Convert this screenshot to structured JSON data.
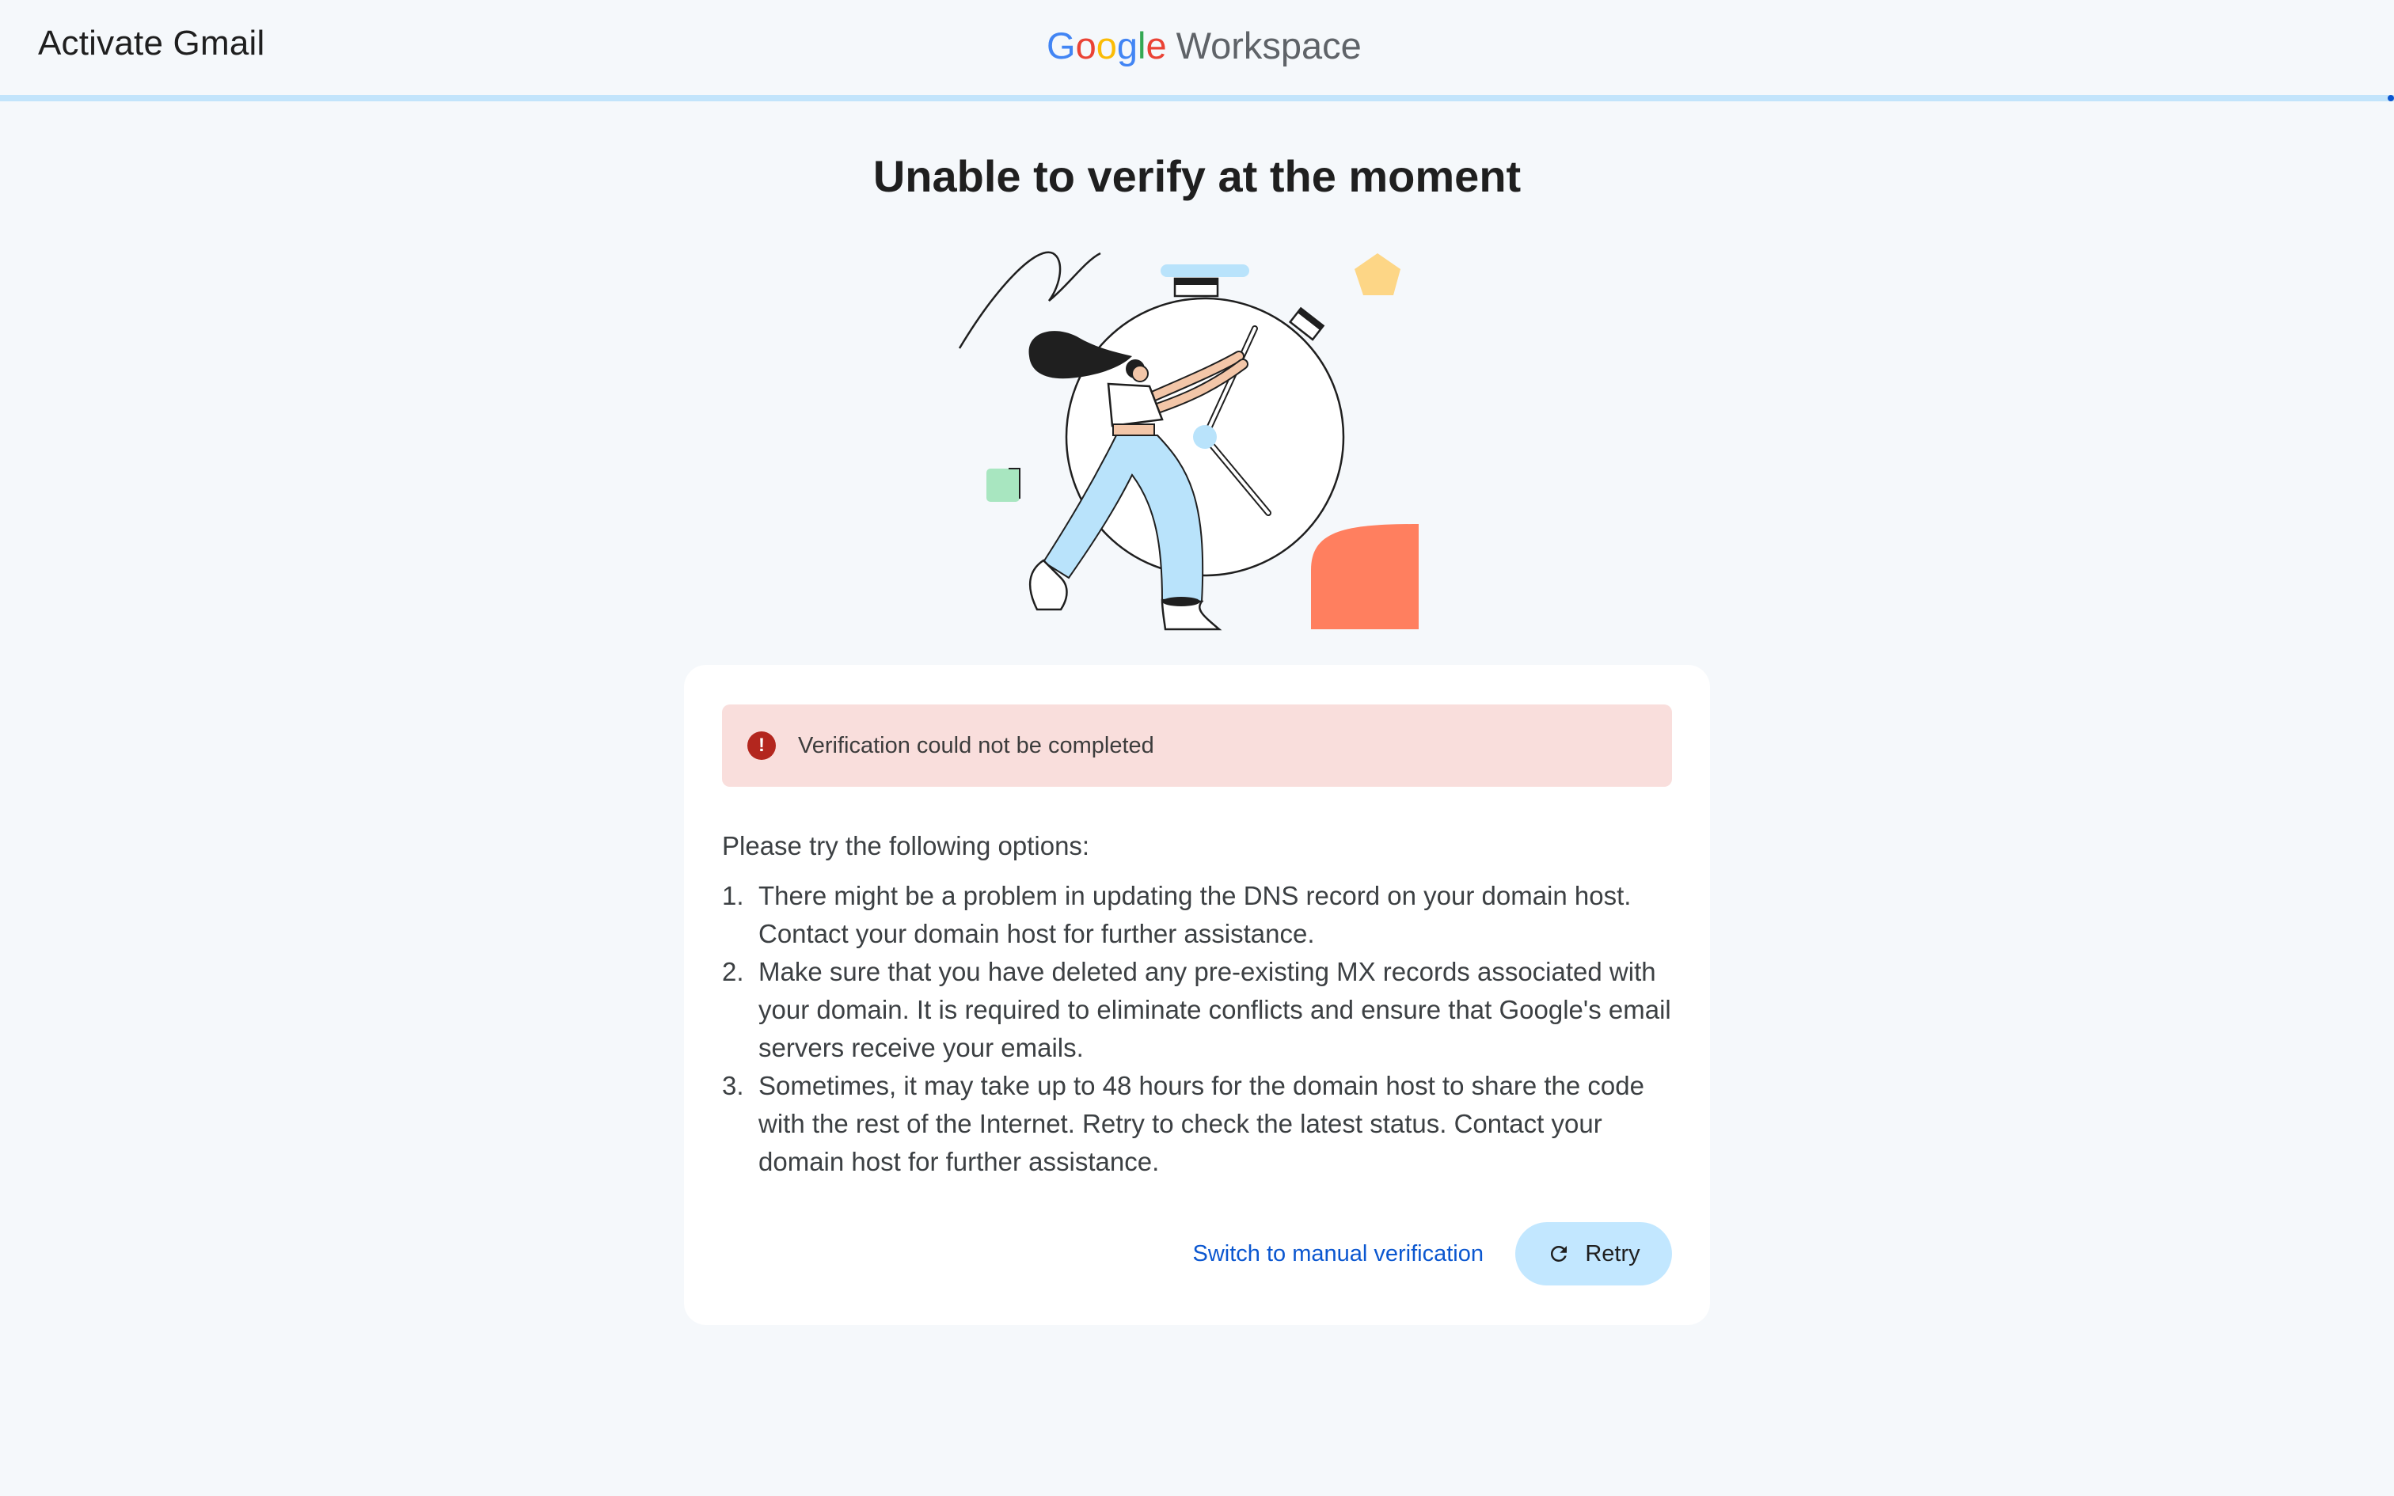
{
  "header": {
    "app_title": "Activate Gmail",
    "brand_google_letters": [
      "G",
      "o",
      "o",
      "g",
      "l",
      "e"
    ],
    "brand_google_colors": [
      "#4285F4",
      "#EA4335",
      "#FBBC05",
      "#4285F4",
      "#34A853",
      "#EA4335"
    ],
    "brand_product": "Workspace"
  },
  "page": {
    "headline": "Unable to verify at the moment"
  },
  "alert": {
    "icon": "error-icon",
    "color": "#b3261e",
    "background": "#f9dedc",
    "message": "Verification could not be completed"
  },
  "instructions": {
    "intro": "Please try the following options:",
    "items": [
      {
        "number": "1.",
        "text": "There might be a problem in updating the DNS record on your domain host. Contact your domain host for further assistance."
      },
      {
        "number": "2.",
        "text": "Make sure that you have deleted any pre-existing MX records associated with your domain. It is required to eliminate conflicts and ensure that Google's email servers receive your emails."
      },
      {
        "number": "3.",
        "text": "Sometimes, it may take up to 48 hours for the domain host to share the code with the rest of the Internet. Retry to check the latest status. Contact your domain host for further assistance."
      }
    ]
  },
  "actions": {
    "manual_label": "Switch to manual verification",
    "retry_label": "Retry",
    "retry_icon": "refresh-icon",
    "accent": "#0b57d0",
    "retry_background": "#c2e7ff"
  },
  "theme": {
    "page_background": "#f5f8fb",
    "progress_track": "#c2e4fb",
    "progress_indicator": "#0b57d0"
  }
}
